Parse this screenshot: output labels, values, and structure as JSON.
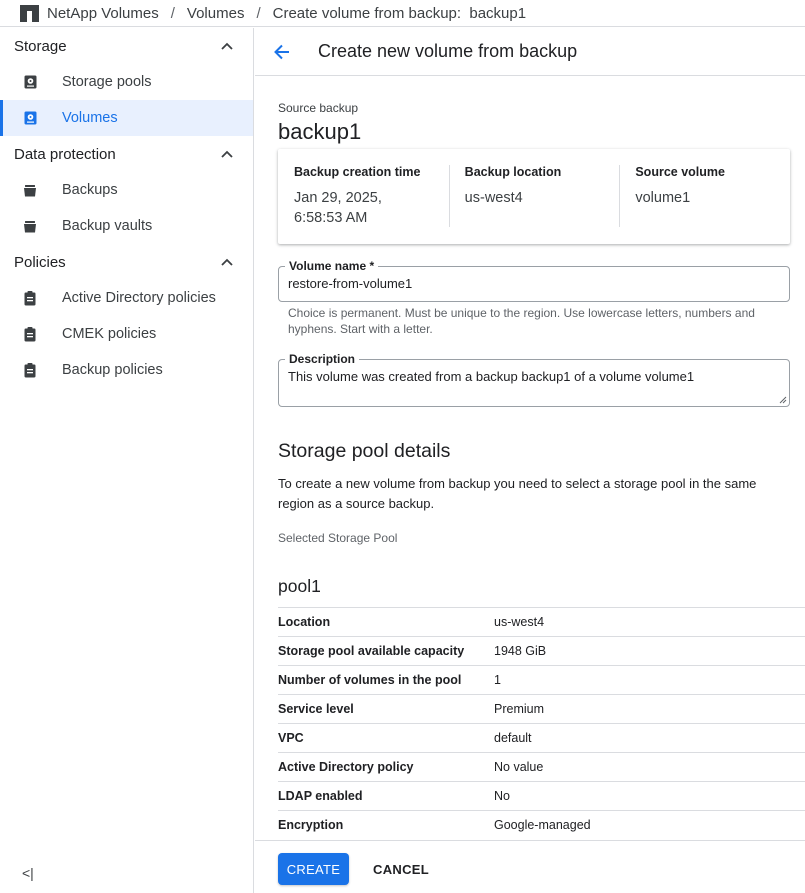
{
  "breadcrumb": {
    "items": [
      "NetApp Volumes",
      "Volumes",
      "Create volume from backup:  backup1"
    ],
    "separator": "/"
  },
  "sidebar": {
    "sections": [
      {
        "title": "Storage",
        "items": [
          {
            "label": "Storage pools",
            "icon": "storage-icon",
            "active": false
          },
          {
            "label": "Volumes",
            "icon": "volume-icon",
            "active": true
          }
        ]
      },
      {
        "title": "Data protection",
        "items": [
          {
            "label": "Backups",
            "icon": "backup-icon",
            "active": false
          },
          {
            "label": "Backup vaults",
            "icon": "vault-icon",
            "active": false
          }
        ]
      },
      {
        "title": "Policies",
        "items": [
          {
            "label": "Active Directory policies",
            "icon": "policy-icon",
            "active": false
          },
          {
            "label": "CMEK policies",
            "icon": "policy-icon",
            "active": false
          },
          {
            "label": "Backup policies",
            "icon": "policy-icon",
            "active": false
          }
        ]
      }
    ],
    "collapse_label": "<|"
  },
  "header": {
    "title": "Create new volume from backup"
  },
  "source": {
    "label": "Source backup",
    "name": "backup1",
    "card": [
      {
        "key": "Backup creation time",
        "value": "Jan 29, 2025, 6:58:53 AM"
      },
      {
        "key": "Backup location",
        "value": "us-west4"
      },
      {
        "key": "Source volume",
        "value": "volume1"
      }
    ]
  },
  "form": {
    "volume_name": {
      "label": "Volume name *",
      "value": "restore-from-volume1",
      "hint": "Choice is permanent. Must be unique to the region. Use lowercase letters, numbers and hyphens. Start with a letter."
    },
    "description": {
      "label": "Description",
      "value": "This volume was created from a backup backup1 of a volume volume1"
    }
  },
  "pool_details": {
    "heading": "Storage pool details",
    "text": "To create a new volume from backup you need to select a storage pool in the same region as a source backup.",
    "selected_label": "Selected Storage Pool",
    "pool_name": "pool1",
    "rows": [
      {
        "key": "Location",
        "value": "us-west4"
      },
      {
        "key": "Storage pool available capacity",
        "value": "1948 GiB"
      },
      {
        "key": "Number of volumes in the pool",
        "value": "1"
      },
      {
        "key": "Service level",
        "value": "Premium"
      },
      {
        "key": "VPC",
        "value": "default"
      },
      {
        "key": "Active Directory policy",
        "value": "No value"
      },
      {
        "key": "LDAP enabled",
        "value": "No"
      },
      {
        "key": "Encryption",
        "value": "Google-managed"
      }
    ]
  },
  "footer": {
    "create_label": "CREATE",
    "cancel_label": "CANCEL"
  },
  "colors": {
    "accent": "#1a73e8",
    "active_bg": "#e8f0fe",
    "border": "#dadce0"
  }
}
